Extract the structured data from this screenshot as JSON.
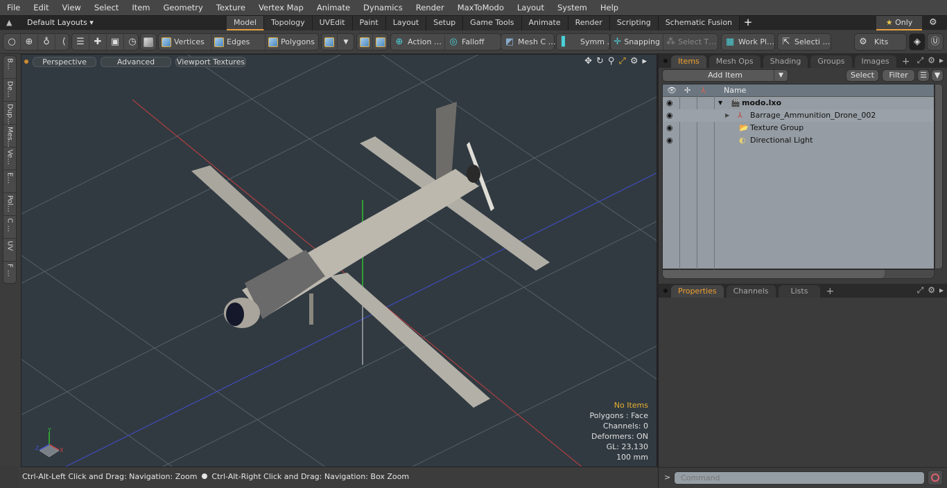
{
  "menu": [
    "File",
    "Edit",
    "View",
    "Select",
    "Item",
    "Geometry",
    "Texture",
    "Vertex Map",
    "Animate",
    "Dynamics",
    "Render",
    "MaxToModo",
    "Layout",
    "System",
    "Help"
  ],
  "layoutbar": {
    "layouts_label": "Default Layouts ▾",
    "tabs": [
      "Model",
      "Topology",
      "UVEdit",
      "Paint",
      "Layout",
      "Setup",
      "Game Tools",
      "Animate",
      "Render",
      "Scripting",
      "Schematic Fusion"
    ],
    "active_tab": "Model",
    "add_tab": "+",
    "only_label": "Only",
    "star": "★"
  },
  "toolbar": {
    "vertices": "Vertices",
    "edges": "Edges",
    "polygons": "Polygons",
    "action": "Action …",
    "falloff": "Falloff",
    "mesh_c": "Mesh C …",
    "symm": "Symm …",
    "snapping": "Snapping",
    "select_t": "Select T…",
    "work_pl": "Work Pl…",
    "selecti": "Selecti …",
    "kits": "Kits"
  },
  "left_tabs": [
    "B…",
    "De…",
    "Dup…",
    "Mes…",
    "Ve…",
    "E…",
    "Pol…",
    "C …",
    "UV",
    "F …"
  ],
  "viewport": {
    "perspective": "Perspective",
    "advanced": "Advanced",
    "viewport_textures": "Viewport Textures",
    "info": {
      "items": "No Items",
      "polygons": "Polygons : Face",
      "channels": "Channels: 0",
      "deformers": "Deformers: ON",
      "gl": "GL: 23,130",
      "scale": "100 mm"
    },
    "axis_labels": {
      "x": "X",
      "y": "Y",
      "z": "Z"
    },
    "colors": {
      "bg": "#313a41",
      "x_axis": "#c84040",
      "y_axis": "#30c030",
      "z_axis": "#4050d0",
      "model": "#b8b4aa"
    }
  },
  "status": {
    "left": "Ctrl-Alt-Left Click and Drag: Navigation: Zoom",
    "right": "Ctrl-Alt-Right Click and Drag: Navigation: Box Zoom"
  },
  "items_panel": {
    "tabs": [
      "Items",
      "Mesh Ops",
      "Shading",
      "Groups",
      "Images"
    ],
    "active_tab": "Items",
    "add_item": "Add Item",
    "select": "Select",
    "filter": "Filter",
    "column_name": "Name",
    "rows": [
      {
        "label": "modo.lxo",
        "bold": true,
        "indent": 0
      },
      {
        "label": "Barrage_Ammunition_Drone_002",
        "bold": false,
        "indent": 1
      },
      {
        "label": "Texture Group",
        "bold": false,
        "indent": 1
      },
      {
        "label": "Directional Light",
        "bold": false,
        "indent": 1
      }
    ]
  },
  "properties_panel": {
    "tabs": [
      "Properties",
      "Channels",
      "Lists"
    ],
    "active_tab": "Properties"
  },
  "command": {
    "placeholder": "Command",
    "prompt": ">"
  }
}
